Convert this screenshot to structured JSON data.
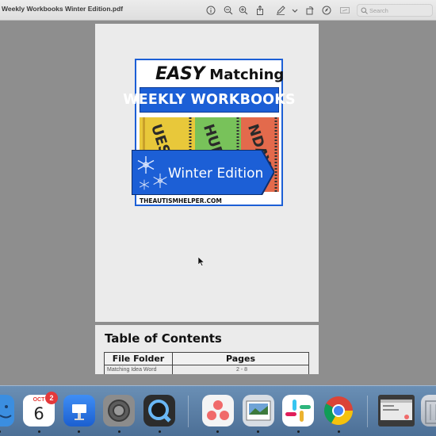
{
  "window": {
    "title": "Weekly Workbooks Winter Edition.pdf"
  },
  "toolbar": {
    "icons": [
      "info-icon",
      "zoom-out-icon",
      "zoom-in-icon",
      "share-icon",
      "markup-pen-icon",
      "chevron-down-icon",
      "rotate-icon",
      "markup-circle-icon",
      "form-icon"
    ],
    "search_placeholder": "Search"
  },
  "cover": {
    "easy": "EASY",
    "matching": "Matching",
    "banner": "WEEKLY WORKBOOKS",
    "folders": [
      "UESDA",
      "HURS",
      "NDAY"
    ],
    "edition": "Winter Edition",
    "brand": "THEAUTISMHELPER.COM",
    "colors": {
      "blue": "#1c5fd6"
    }
  },
  "toc": {
    "title": "Table of Contents",
    "headers": [
      "File Folder",
      "Pages"
    ],
    "rows": [
      [
        "Matching Idea Word",
        "2 - 8"
      ]
    ]
  },
  "dock": {
    "apps": [
      "finder",
      "calendar",
      "keynote",
      "system-settings",
      "quicktime",
      "asana",
      "preview",
      "slack",
      "chrome",
      "screenshot-preview",
      "trash"
    ],
    "calendar": {
      "month": "OCT",
      "day": "6",
      "badge": "2"
    }
  }
}
